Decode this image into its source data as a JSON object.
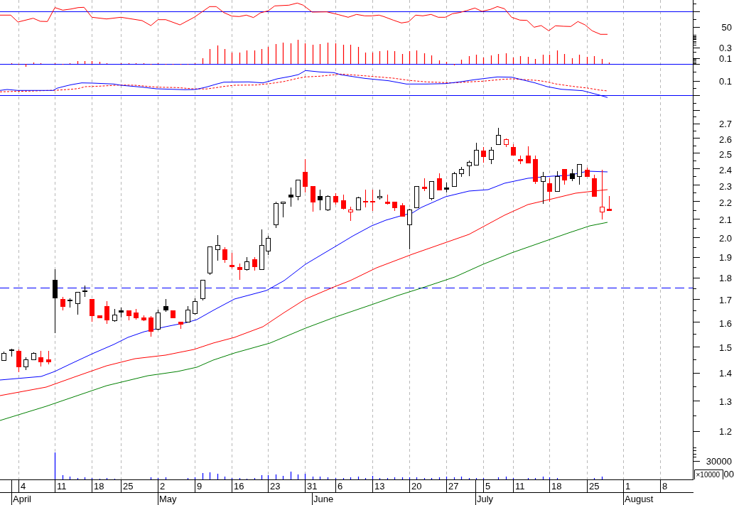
{
  "panels": [
    {
      "kind": "oscillator",
      "axis_labels": [
        "50"
      ]
    },
    {
      "kind": "histogram",
      "axis_labels": [
        "0.3",
        "0.1"
      ]
    },
    {
      "kind": "macd",
      "axis_labels": [
        "0.1"
      ]
    },
    {
      "kind": "price",
      "axis_labels": [
        "2.7",
        "2.6",
        "2.5",
        "2.4",
        "2.3",
        "2.2",
        "2.1",
        "2.0",
        "1.9",
        "1.8",
        "1.7",
        "1.6",
        "1.5",
        "1.4",
        "1.3",
        "1.2"
      ]
    },
    {
      "kind": "volume",
      "axis_labels": [
        "30000"
      ],
      "unit": "×10000",
      "covered_label": "00"
    }
  ],
  "date_axis": {
    "days": [
      "4",
      "11",
      "18",
      "25",
      "2",
      "9",
      "16",
      "23",
      "31",
      "6",
      "13",
      "20",
      "27",
      "5",
      "11",
      "18",
      "25",
      "1",
      "8"
    ],
    "months": [
      "April",
      "May",
      "June",
      "July",
      "August"
    ]
  }
}
